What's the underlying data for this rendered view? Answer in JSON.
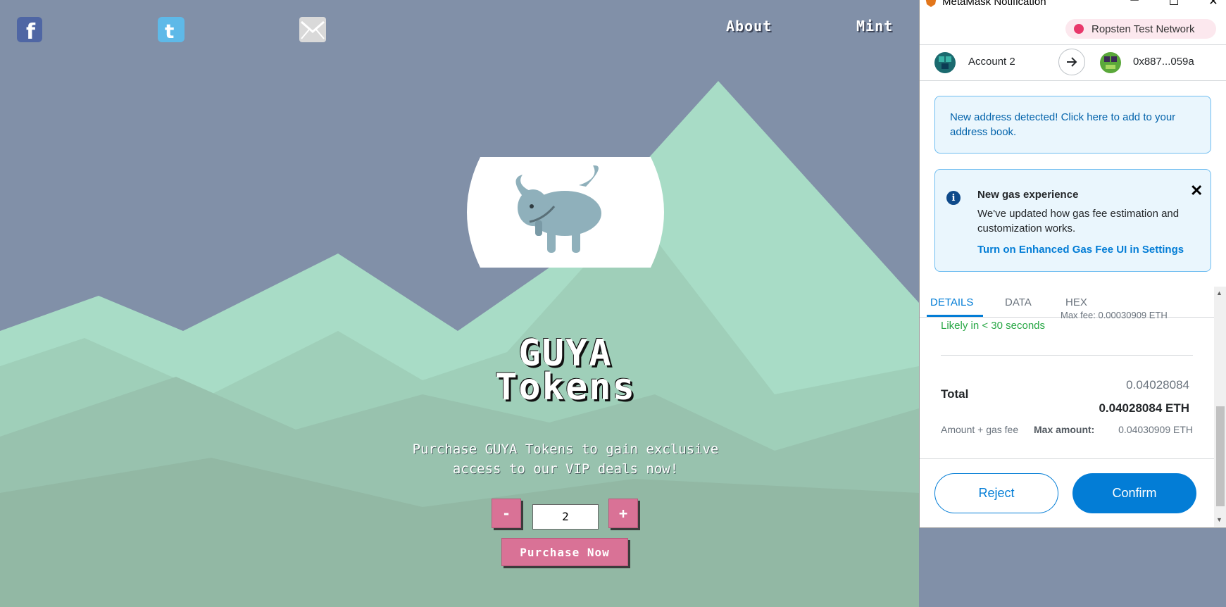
{
  "site": {
    "nav": {
      "about": "About",
      "mint": "Mint"
    },
    "social": [
      "facebook-icon",
      "twitter-icon",
      "email-icon"
    ],
    "title_line1": "GUYA",
    "title_line2": "Tokens",
    "subtitle_line1": "Purchase GUYA Tokens to gain exclusive",
    "subtitle_line2": "access to our VIP deals now!",
    "minus_label": "-",
    "plus_label": "+",
    "quantity": "2",
    "purchase_label": "Purchase Now",
    "colors": {
      "sky": "#8190a8",
      "mountain_light": "#a8dcc6",
      "button": "#d97296"
    }
  },
  "metamask": {
    "window_title": "MetaMask Notification",
    "network": "Ropsten Test Network",
    "from_account": "Account 2",
    "to_address": "0x887...059a",
    "address_notice": "New address detected! Click here to add to your address book.",
    "gas_notice": {
      "title": "New gas experience",
      "description": "We've updated how gas fee estimation and customization works.",
      "link": "Turn on Enhanced Gas Fee UI in Settings"
    },
    "tabs": [
      "DETAILS",
      "DATA",
      "HEX"
    ],
    "active_tab": "DETAILS",
    "likely_text": "Likely in < 30 seconds",
    "max_fee_text": "Max fee: 0.00030909 ETH",
    "total": {
      "label": "Total",
      "amount": "0.04028084",
      "amount_eth": "0.04028084 ETH",
      "subtext": "Amount + gas fee",
      "max_amount_label": "Max amount:",
      "max_amount_value": "0.04030909 ETH"
    },
    "buttons": {
      "reject": "Reject",
      "confirm": "Confirm"
    },
    "colors": {
      "primary": "#037dd6",
      "success": "#28a745",
      "network_dot": "#e8386b"
    }
  }
}
